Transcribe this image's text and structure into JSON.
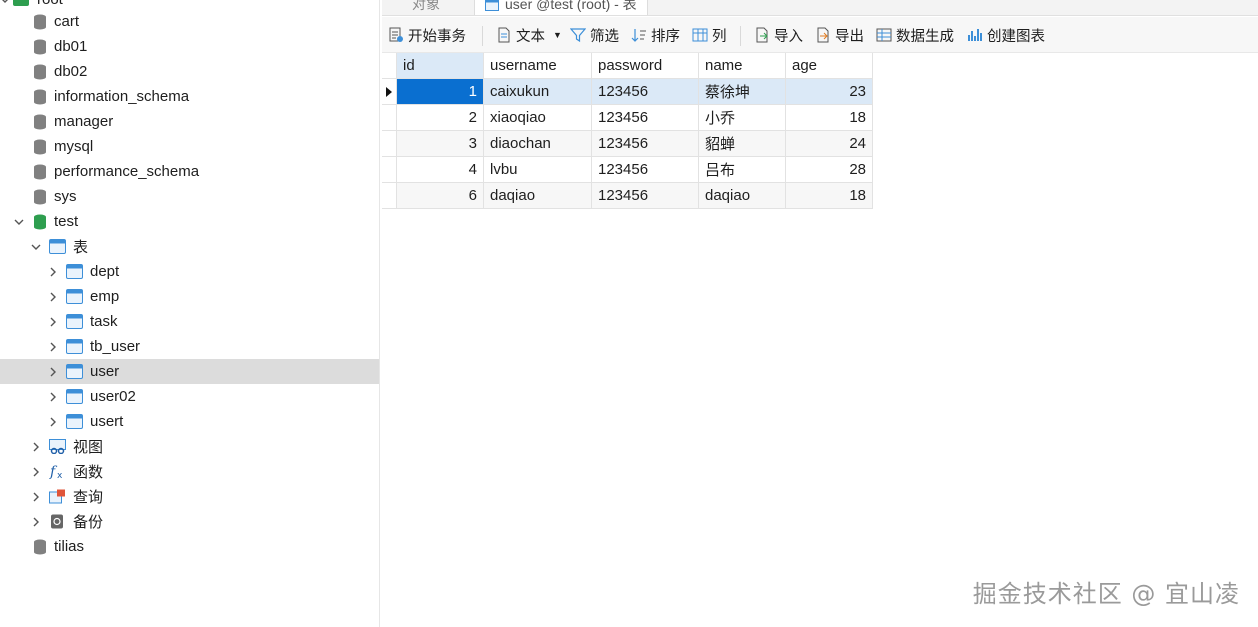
{
  "tree": {
    "connection_label": "root",
    "databases": [
      "cart",
      "db01",
      "db02",
      "information_schema",
      "manager",
      "mysql",
      "performance_schema",
      "sys",
      "test",
      "tilias"
    ],
    "tables_group": "表",
    "tables": [
      "dept",
      "emp",
      "task",
      "tb_user",
      "user",
      "user02",
      "usert"
    ],
    "selected_table": "user",
    "groups": [
      "视图",
      "函数",
      "查询",
      "备份"
    ]
  },
  "tabs": {
    "objects": "对象",
    "active": "user @test (root) - 表"
  },
  "toolbar": {
    "begin_tx": "开始事务",
    "text": "文本",
    "filter": "筛选",
    "sort": "排序",
    "columns": "列",
    "import": "导入",
    "export": "导出",
    "data_gen": "数据生成",
    "create_chart": "创建图表"
  },
  "grid": {
    "columns": [
      "id",
      "username",
      "password",
      "name",
      "age"
    ],
    "rows": [
      [
        "1",
        "caixukun",
        "123456",
        "蔡徐坤",
        "23"
      ],
      [
        "2",
        "xiaoqiao",
        "123456",
        "小乔",
        "18"
      ],
      [
        "3",
        "diaochan",
        "123456",
        "貂蝉",
        "24"
      ],
      [
        "4",
        "lvbu",
        "123456",
        "吕布",
        "28"
      ],
      [
        "6",
        "daqiao",
        "123456",
        "daqiao",
        "18"
      ]
    ]
  },
  "watermark": "掘金技术社区 @ 宜山凌",
  "colors": {
    "selected_cell": "#0a6fd0",
    "selected_row": "#dbe9f7",
    "db_icon": "#808080",
    "db_active_icon": "#2e9e4f",
    "table_icon": "#3d8fd8"
  }
}
